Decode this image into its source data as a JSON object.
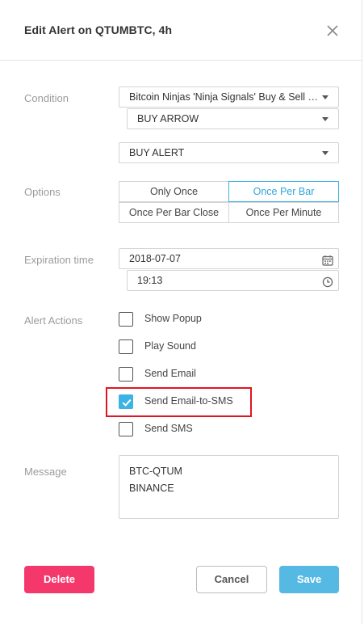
{
  "dialog": {
    "title": "Edit Alert on QTUMBTC, 4h"
  },
  "condition": {
    "label": "Condition",
    "indicator": "Bitcoin Ninjas 'Ninja Signals' Buy & Sell Signals",
    "signal": "BUY ARROW",
    "alert": "BUY ALERT"
  },
  "options": {
    "label": "Options",
    "choices": [
      "Only Once",
      "Once Per Bar",
      "Once Per Bar Close",
      "Once Per Minute"
    ],
    "selected": "Once Per Bar"
  },
  "expiration": {
    "label": "Expiration time",
    "date": "2018-07-07",
    "time": "19:13"
  },
  "actions": {
    "label": "Alert Actions",
    "items": [
      {
        "label": "Show Popup",
        "checked": false
      },
      {
        "label": "Play Sound",
        "checked": false
      },
      {
        "label": "Send Email",
        "checked": false
      },
      {
        "label": "Send Email-to-SMS",
        "checked": true
      },
      {
        "label": "Send SMS",
        "checked": false
      }
    ]
  },
  "message": {
    "label": "Message",
    "lines": [
      "BTC-QTUM",
      "BINANCE"
    ]
  },
  "buttons": {
    "delete": "Delete",
    "cancel": "Cancel",
    "save": "Save"
  },
  "colors": {
    "accent": "#3bb3e4",
    "delete": "#f5386c",
    "save": "#55b9e3",
    "highlight": "#e0161e"
  },
  "icons": {
    "close": "close-icon",
    "calendar": "calendar-icon",
    "clock": "clock-icon",
    "caret": "chevron-down-icon",
    "check": "check-icon"
  }
}
